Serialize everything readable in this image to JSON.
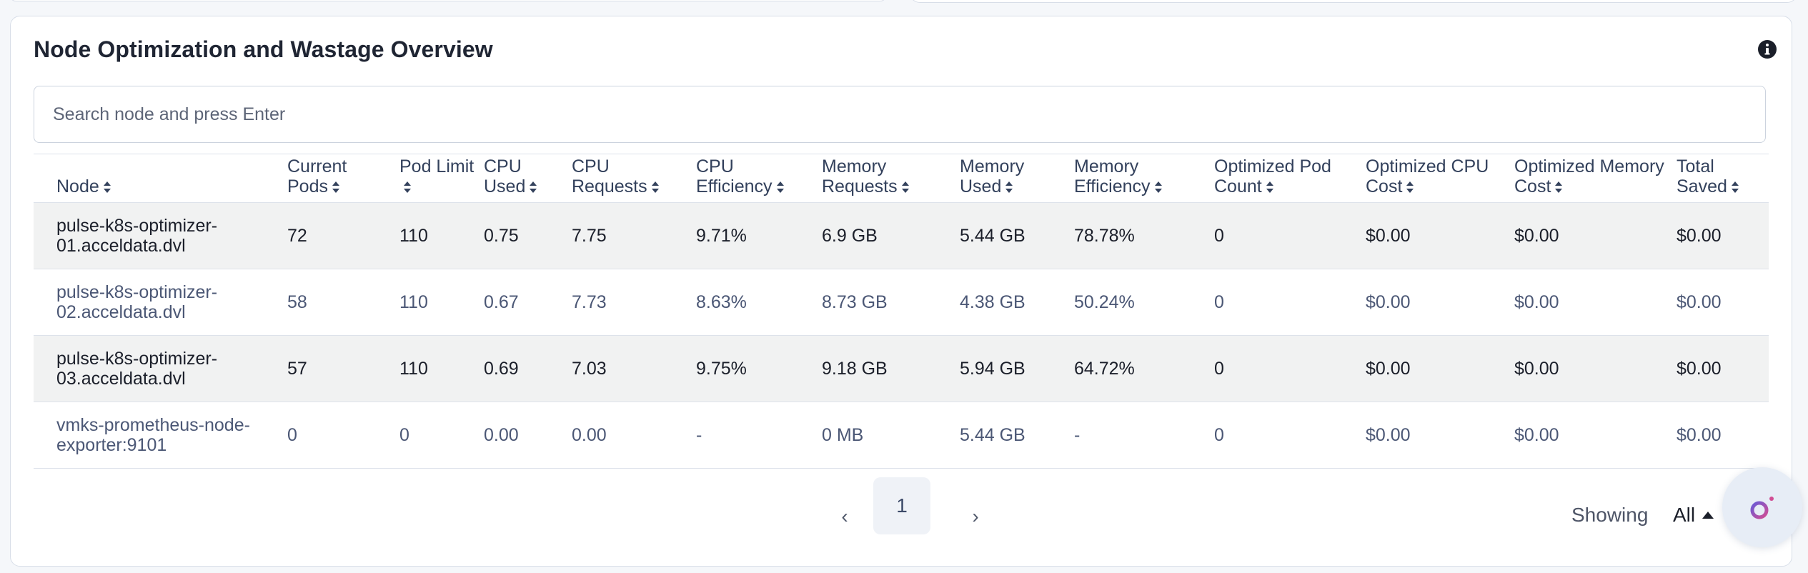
{
  "card": {
    "title": "Node Optimization and Wastage Overview",
    "info_icon": "info-icon"
  },
  "search": {
    "placeholder": "Search node and press Enter",
    "value": ""
  },
  "table": {
    "headers": {
      "node": "Node",
      "current_pods": "Current Pods",
      "pod_limit": "Pod Limit",
      "cpu_used": "CPU Used",
      "cpu_requests": "CPU Requests",
      "cpu_efficiency": "CPU Efficiency",
      "memory_requests": "Memory Requests",
      "memory_used": "Memory Used",
      "memory_efficiency": "Memory Efficiency",
      "optimized_pod_count": "Optimized Pod Count",
      "optimized_cpu_cost": "Optimized CPU Cost",
      "optimized_memory_cost": "Optimized Memory Cost",
      "total_saved": "Total Saved"
    },
    "sort_icon": "sort-icon",
    "rows": [
      {
        "node": "pulse-k8s-optimizer-01.acceldata.dvl",
        "current_pods": "72",
        "pod_limit": "110",
        "cpu_used": "0.75",
        "cpu_requests": "7.75",
        "cpu_efficiency": "9.71%",
        "memory_requests": "6.9 GB",
        "memory_used": "5.44 GB",
        "memory_efficiency": "78.78%",
        "optimized_pod_count": "0",
        "optimized_cpu_cost": "$0.00",
        "optimized_memory_cost": "$0.00",
        "total_saved": "$0.00"
      },
      {
        "node": "pulse-k8s-optimizer-02.acceldata.dvl",
        "current_pods": "58",
        "pod_limit": "110",
        "cpu_used": "0.67",
        "cpu_requests": "7.73",
        "cpu_efficiency": "8.63%",
        "memory_requests": "8.73 GB",
        "memory_used": "4.38 GB",
        "memory_efficiency": "50.24%",
        "optimized_pod_count": "0",
        "optimized_cpu_cost": "$0.00",
        "optimized_memory_cost": "$0.00",
        "total_saved": "$0.00"
      },
      {
        "node": "pulse-k8s-optimizer-03.acceldata.dvl",
        "current_pods": "57",
        "pod_limit": "110",
        "cpu_used": "0.69",
        "cpu_requests": "7.03",
        "cpu_efficiency": "9.75%",
        "memory_requests": "9.18 GB",
        "memory_used": "5.94 GB",
        "memory_efficiency": "64.72%",
        "optimized_pod_count": "0",
        "optimized_cpu_cost": "$0.00",
        "optimized_memory_cost": "$0.00",
        "total_saved": "$0.00"
      },
      {
        "node": "vmks-prometheus-node-exporter:9101",
        "current_pods": "0",
        "pod_limit": "0",
        "cpu_used": "0.00",
        "cpu_requests": "0.00",
        "cpu_efficiency": "-",
        "memory_requests": "0 MB",
        "memory_used": "5.44 GB",
        "memory_efficiency": "-",
        "optimized_pod_count": "0",
        "optimized_cpu_cost": "$0.00",
        "optimized_memory_cost": "$0.00",
        "total_saved": "$0.00"
      }
    ]
  },
  "pagination": {
    "prev": "‹",
    "next": "›",
    "current_page": "1",
    "showing_label": "Showing",
    "showing_value": "All"
  },
  "assistant": {
    "icon": "assistant-logo-icon"
  }
}
